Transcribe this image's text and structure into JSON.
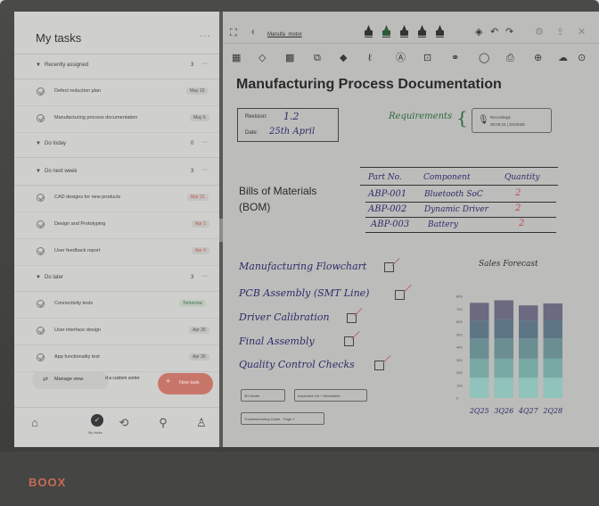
{
  "device": {
    "brand": "BOOX"
  },
  "sidebar": {
    "title": "My tasks",
    "more": "···",
    "groups": [
      {
        "label": "Recently assigned",
        "count": "3",
        "more": "···"
      },
      {
        "label": "Do today",
        "count": "0",
        "more": "···"
      },
      {
        "label": "Do next week",
        "count": "3",
        "more": "···"
      },
      {
        "label": "Do later",
        "count": "3",
        "more": "···"
      }
    ],
    "tasks": [
      {
        "label": "Defect reduction plan",
        "date": "May 10",
        "tone": "normal"
      },
      {
        "label": "Manufacturing process documentation",
        "date": "May 6",
        "tone": "normal"
      },
      {
        "label": "CAD designs for new products",
        "date": "Mar 31",
        "tone": "red"
      },
      {
        "label": "Design and Prototyping",
        "date": "Apr 1",
        "tone": "red"
      },
      {
        "label": "User feedback report",
        "date": "Apr 4",
        "tone": "red"
      },
      {
        "label": "Connectivity tests",
        "date": "Tomorrow",
        "tone": "green"
      },
      {
        "label": "User interface design",
        "date": "Apr 26",
        "tone": "normal"
      },
      {
        "label": "App functionality test",
        "date": "Apr 26",
        "tone": "normal"
      }
    ],
    "manage_view": "Manage view",
    "custom_sort": "d a custom sorter",
    "new_task": "New task",
    "nav_label": "My tasks"
  },
  "toolbar": {
    "note_name": "Manufa_motor"
  },
  "document": {
    "title": "Manufacturing Process Documentation",
    "revision_label": "Revision:",
    "revision_value": "1.2",
    "date_label": "Date:",
    "date_value": "25th April",
    "requirements": "Requirements",
    "recording_title": "Recording1",
    "recording_meta": "00:00:24 | 3/4/2025",
    "bom_line1": "Bills of Materials",
    "bom_line2": "(BOM)",
    "bom_headers": [
      "Part No.",
      "Component",
      "Quantity"
    ],
    "bom_rows": [
      {
        "part": "ABP-001",
        "component": "Bluetooth SoC",
        "qty": "2"
      },
      {
        "part": "ABP-002",
        "component": "Dynamic Driver",
        "qty": "2"
      },
      {
        "part": "ABP-003",
        "component": "Battery",
        "qty": "2"
      }
    ],
    "checklist": [
      "Manufacturing Flowchart",
      "PCB Assembly (SMT Line)",
      "Driver Calibration",
      "Final Assembly",
      "Quality Control Checks"
    ],
    "attachments": [
      "3D Model",
      "Inspection Kit + Worksheet",
      "Troubleshooting Guide - Page 1"
    ]
  },
  "chart_data": {
    "type": "bar",
    "title": "Sales Forecast",
    "categories": [
      "2Q25",
      "3Q26",
      "4Q27",
      "2Q28"
    ],
    "stacked": true,
    "ylim": [
      0,
      900
    ],
    "yticks": [
      0,
      100,
      200,
      300,
      400,
      500,
      600,
      700,
      800
    ],
    "series": [
      {
        "values": [
          160,
          160,
          160,
          160
        ],
        "color": "#8fc3bb"
      },
      {
        "values": [
          150,
          150,
          150,
          150
        ],
        "color": "#78a9a4"
      },
      {
        "values": [
          160,
          160,
          160,
          160
        ],
        "color": "#6b8e92"
      },
      {
        "values": [
          140,
          150,
          140,
          145
        ],
        "color": "#5e7585"
      },
      {
        "values": [
          140,
          150,
          120,
          130
        ],
        "color": "#6b6a80"
      }
    ]
  }
}
